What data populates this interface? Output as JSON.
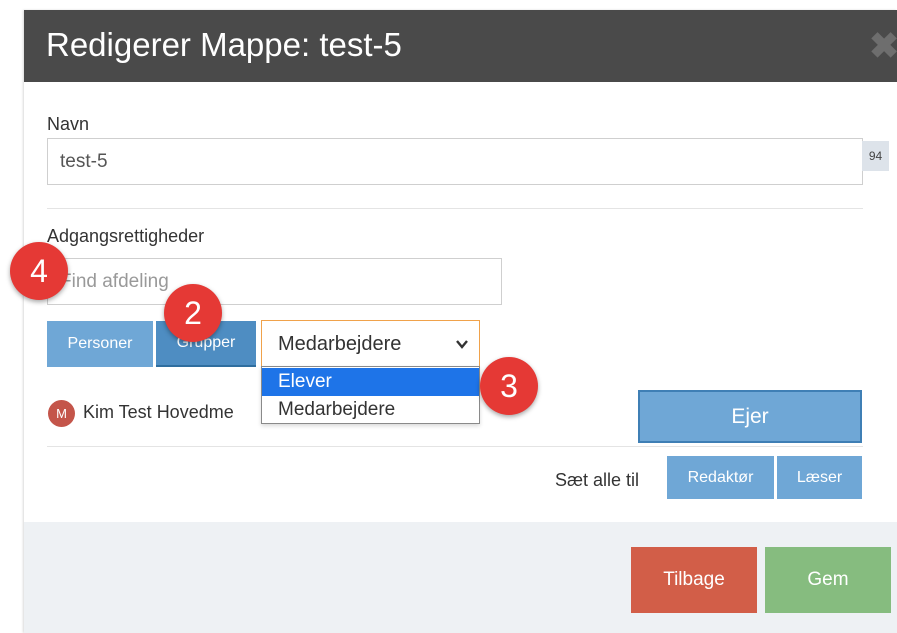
{
  "modal": {
    "title": "Redigerer Mappe: test-5",
    "close_symbol": "✖"
  },
  "name_field": {
    "label": "Navn",
    "value": "test-5",
    "counter": "94"
  },
  "access": {
    "label": "Adgangsrettigheder",
    "search_placeholder": "Find afdeling",
    "tabs": [
      {
        "label": "Personer"
      },
      {
        "label": "Grupper"
      }
    ],
    "group_select": {
      "selected": "Medarbejdere",
      "options": [
        "Elever",
        "Medarbejdere"
      ],
      "highlighted": "Elever"
    }
  },
  "member": {
    "avatar_initial": "M",
    "name": "Kim Test Hovedme",
    "role_button": "Ejer"
  },
  "set_all": {
    "label": "Sæt alle til",
    "editor_label": "Redaktør",
    "reader_label": "Læser"
  },
  "footer": {
    "back_label": "Tilbage",
    "save_label": "Gem",
    "back_color": "#d25e48",
    "save_color": "#86bc7f"
  },
  "annotations": [
    "4",
    "2",
    "3"
  ]
}
